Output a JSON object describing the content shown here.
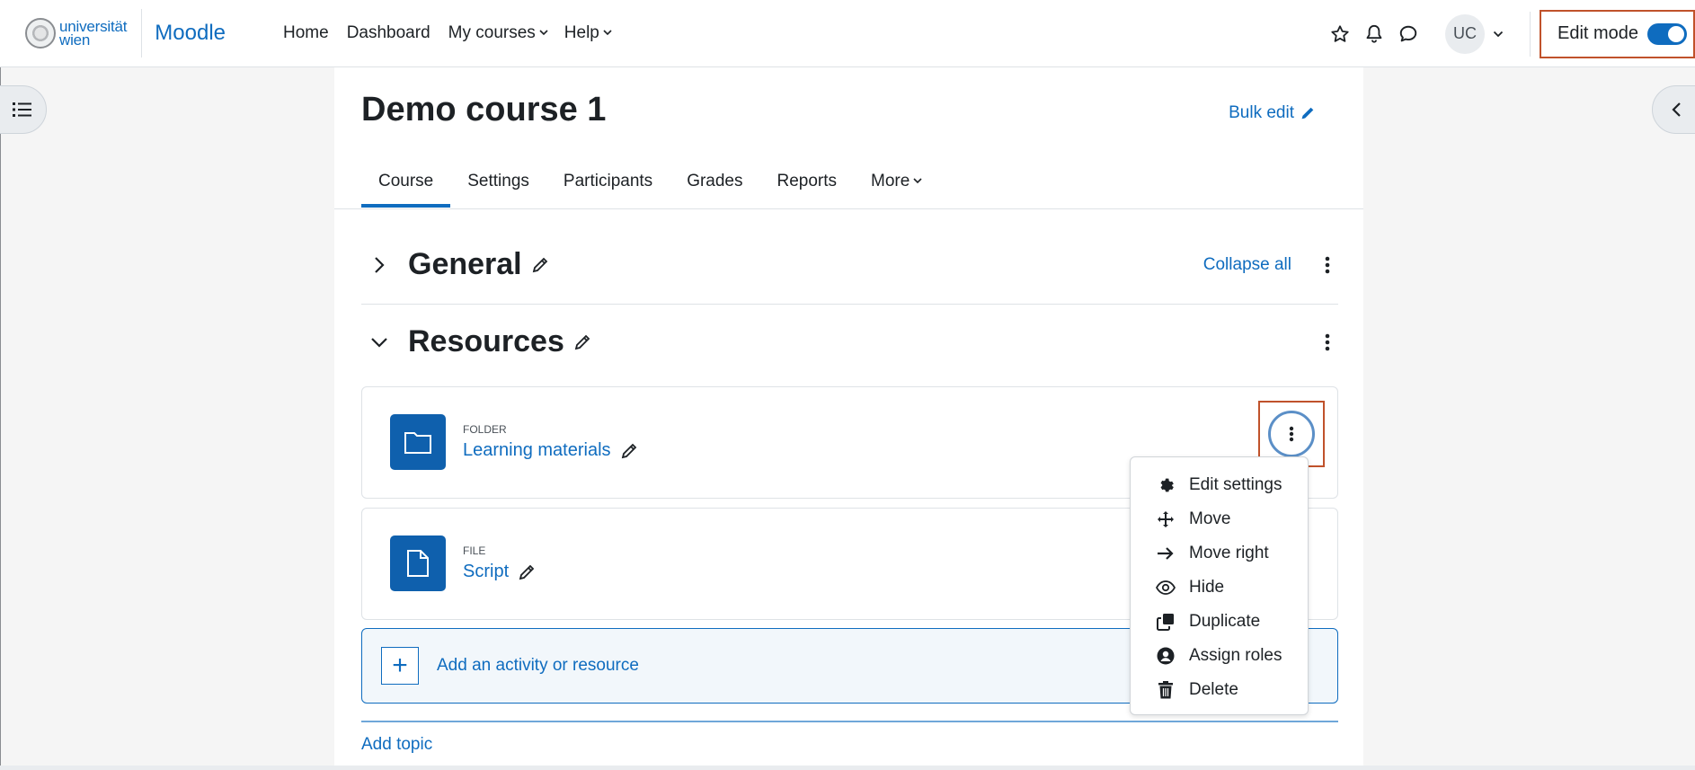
{
  "header": {
    "logo_lines": [
      "universität",
      "wien"
    ],
    "brand": "Moodle",
    "nav": [
      {
        "label": "Home",
        "has_caret": false
      },
      {
        "label": "Dashboard",
        "has_caret": false
      },
      {
        "label": "My courses",
        "has_caret": true
      },
      {
        "label": "Help",
        "has_caret": true
      }
    ],
    "icons": [
      "star-icon",
      "bell-icon",
      "message-icon"
    ],
    "avatar_initials": "UC",
    "edit_mode_label": "Edit mode",
    "edit_mode_on": true
  },
  "course": {
    "title": "Demo course 1",
    "bulk_edit_label": "Bulk edit",
    "tabs": [
      "Course",
      "Settings",
      "Participants",
      "Grades",
      "Reports",
      "More"
    ],
    "active_tab": "Course"
  },
  "sections": {
    "general": {
      "title": "General",
      "collapse_all_label": "Collapse all"
    },
    "resources": {
      "title": "Resources"
    }
  },
  "activities": [
    {
      "type": "FOLDER",
      "name": "Learning materials",
      "icon": "folder-icon"
    },
    {
      "type": "FILE",
      "name": "Script",
      "icon": "file-icon"
    }
  ],
  "add_activity_label": "Add an activity or resource",
  "add_topic_label": "Add topic",
  "action_menu": [
    {
      "label": "Edit settings",
      "icon": "gear-icon"
    },
    {
      "label": "Move",
      "icon": "move-arrows-icon"
    },
    {
      "label": "Move right",
      "icon": "arrow-right-icon"
    },
    {
      "label": "Hide",
      "icon": "eye-icon"
    },
    {
      "label": "Duplicate",
      "icon": "duplicate-icon"
    },
    {
      "label": "Assign roles",
      "icon": "user-circle-icon"
    },
    {
      "label": "Delete",
      "icon": "trash-icon"
    }
  ],
  "colors": {
    "accent": "#0f6cbf",
    "highlight_border": "#c0522b"
  }
}
